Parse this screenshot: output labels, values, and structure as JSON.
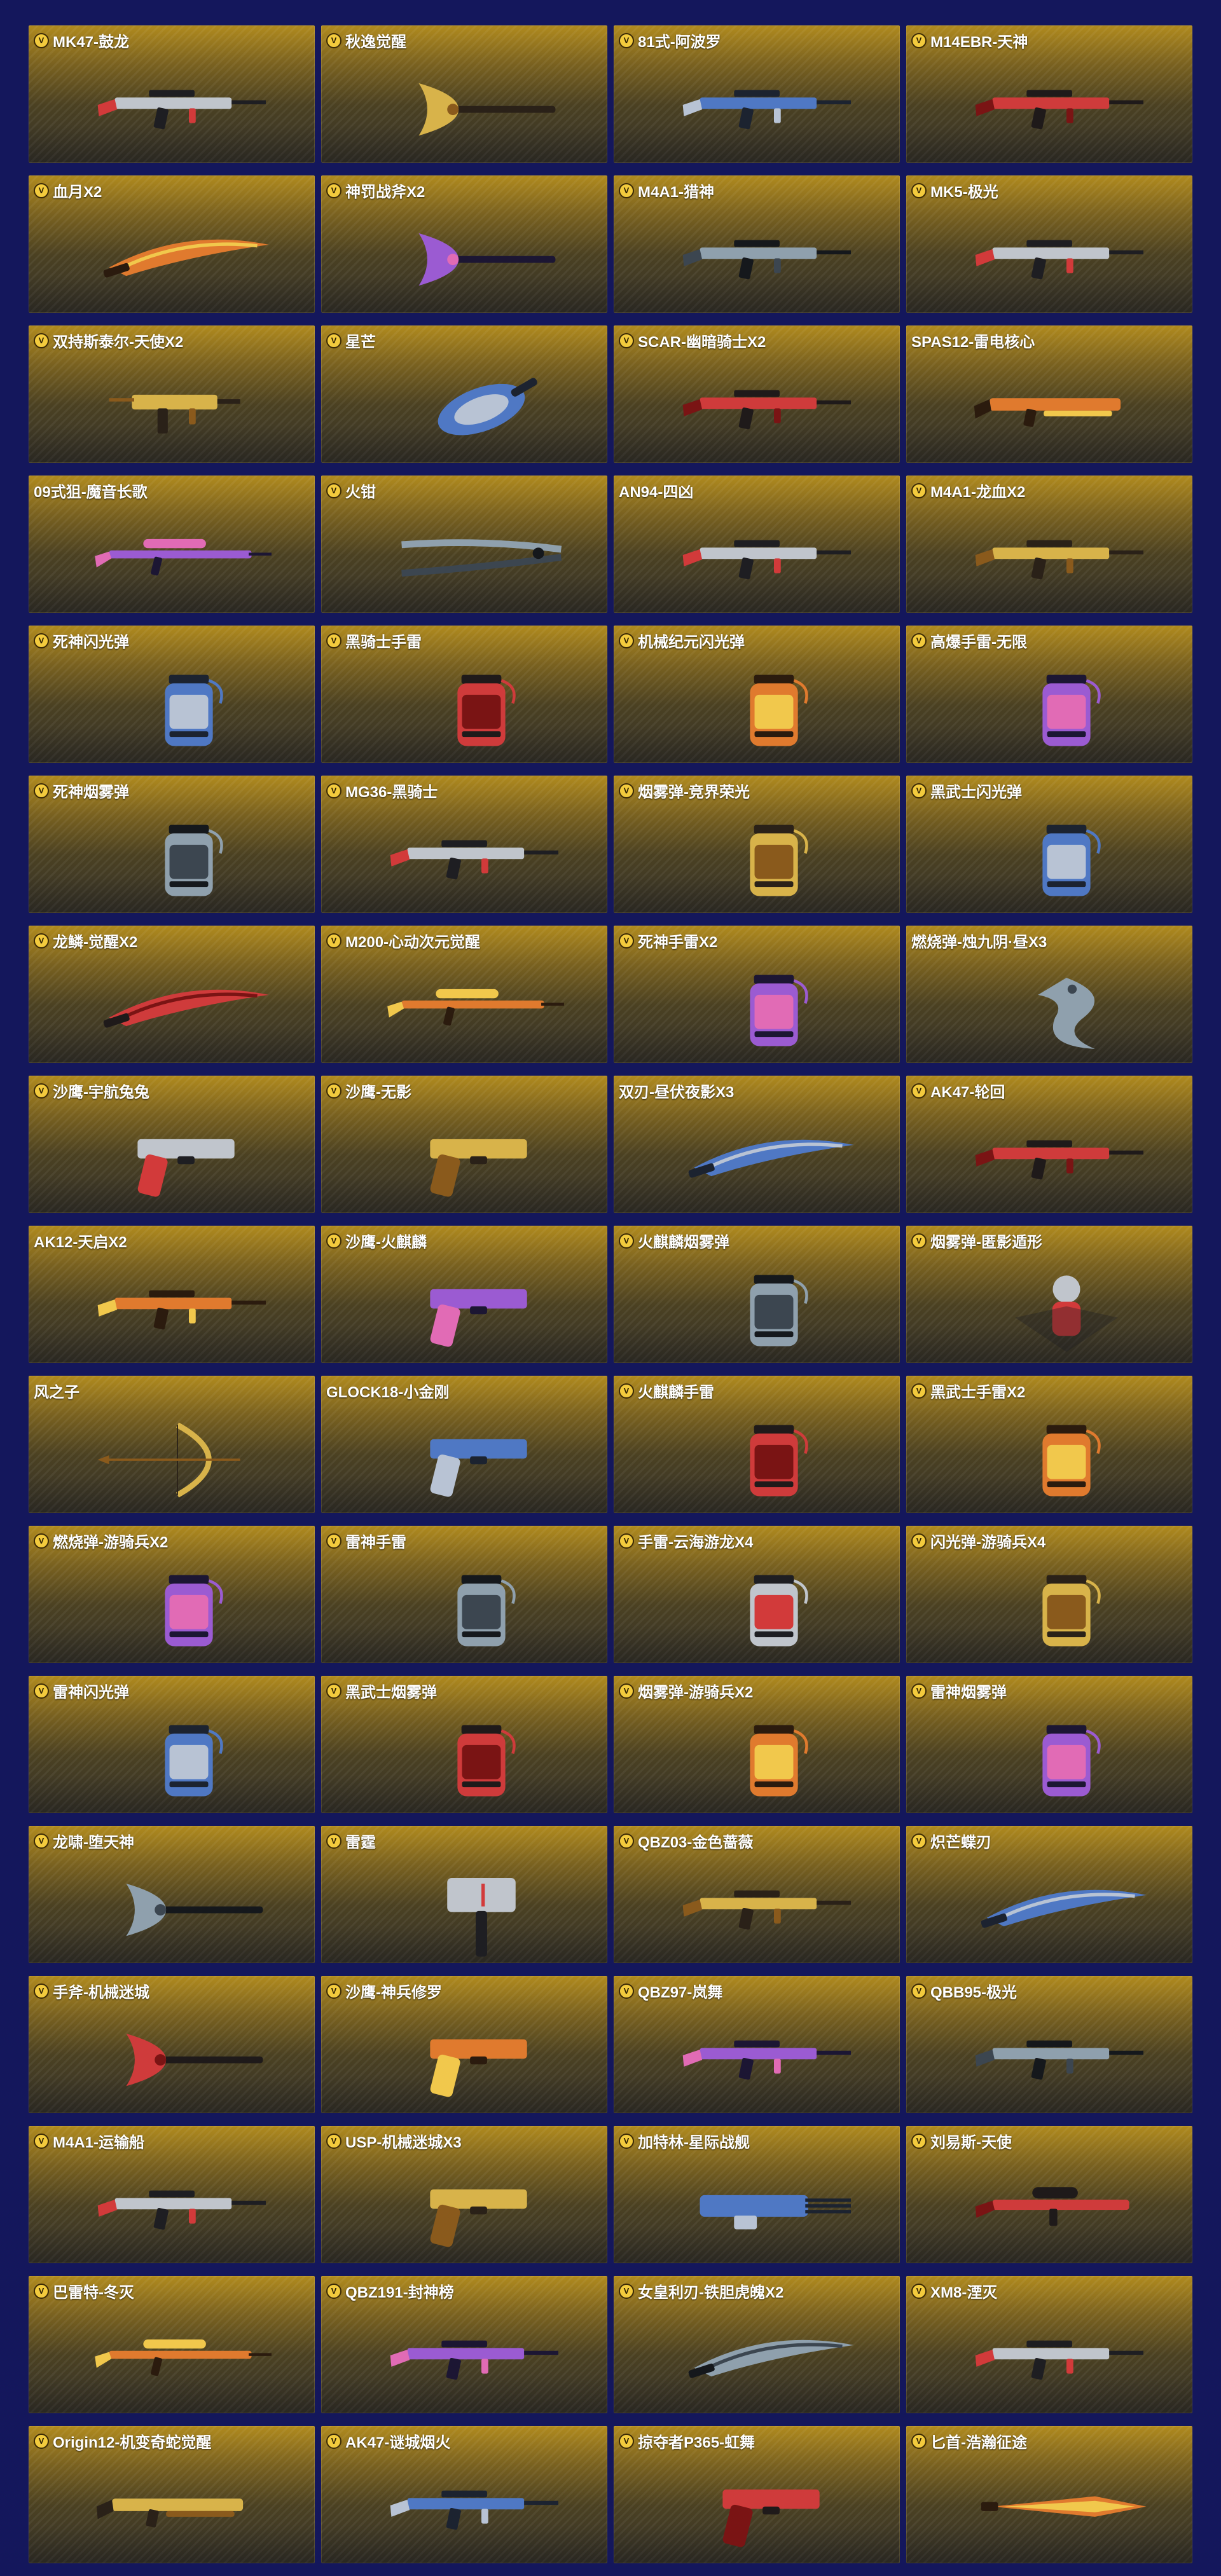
{
  "badge_glyph": "V",
  "colors": {
    "background": "#14175c",
    "badge": "#f3cb3d",
    "card_top": "#b08a1e",
    "card_bottom": "#35322a"
  },
  "items": [
    {
      "label": "MK47-鼓龙",
      "badge": true,
      "icon": "rifle-icon"
    },
    {
      "label": "秋逸觉醒",
      "badge": true,
      "icon": "axe-icon"
    },
    {
      "label": "81式-阿波罗",
      "badge": true,
      "icon": "rifle-icon"
    },
    {
      "label": "M14EBR-天神",
      "badge": true,
      "icon": "rifle-icon"
    },
    {
      "label": "血月X2",
      "badge": true,
      "icon": "blade-icon"
    },
    {
      "label": "神罚战斧X2",
      "badge": true,
      "icon": "axe-icon"
    },
    {
      "label": "M4A1-猎神",
      "badge": true,
      "icon": "rifle-icon"
    },
    {
      "label": "MK5-极光",
      "badge": true,
      "icon": "rifle-icon"
    },
    {
      "label": "双持斯泰尔-天使X2",
      "badge": true,
      "icon": "smg-icon"
    },
    {
      "label": "星芒",
      "badge": true,
      "icon": "gauntlet-icon"
    },
    {
      "label": "SCAR-幽暗骑士X2",
      "badge": true,
      "icon": "rifle-icon"
    },
    {
      "label": "SPAS12-雷电核心",
      "badge": false,
      "icon": "shotgun-icon"
    },
    {
      "label": "09式狙-魔音长歌",
      "badge": false,
      "icon": "sniper-icon"
    },
    {
      "label": "火钳",
      "badge": true,
      "icon": "tongs-icon"
    },
    {
      "label": "AN94-四凶",
      "badge": false,
      "icon": "rifle-icon"
    },
    {
      "label": "M4A1-龙血X2",
      "badge": true,
      "icon": "rifle-icon"
    },
    {
      "label": "死神闪光弹",
      "badge": true,
      "icon": "grenade-icon"
    },
    {
      "label": "黑骑士手雷",
      "badge": true,
      "icon": "grenade-icon"
    },
    {
      "label": "机械纪元闪光弹",
      "badge": true,
      "icon": "grenade-icon"
    },
    {
      "label": "高爆手雷-无限",
      "badge": true,
      "icon": "grenade-icon"
    },
    {
      "label": "死神烟雾弹",
      "badge": true,
      "icon": "grenade-icon"
    },
    {
      "label": "MG36-黑骑士",
      "badge": true,
      "icon": "rifle-icon"
    },
    {
      "label": "烟雾弹-竞界荣光",
      "badge": true,
      "icon": "grenade-icon"
    },
    {
      "label": "黑武士闪光弹",
      "badge": true,
      "icon": "grenade-icon"
    },
    {
      "label": "龙鳞-觉醒X2",
      "badge": true,
      "icon": "blade-icon"
    },
    {
      "label": "M200-心动次元觉醒",
      "badge": true,
      "icon": "sniper-icon"
    },
    {
      "label": "死神手雷X2",
      "badge": true,
      "icon": "grenade-icon"
    },
    {
      "label": "燃烧弹-烛九阴·昼X3",
      "badge": false,
      "icon": "dragon-figure-icon"
    },
    {
      "label": "沙鹰-宇航兔兔",
      "badge": true,
      "icon": "pistol-icon"
    },
    {
      "label": "沙鹰-无影",
      "badge": true,
      "icon": "pistol-icon"
    },
    {
      "label": "双刃-昼伏夜影X3",
      "badge": false,
      "icon": "blade-icon"
    },
    {
      "label": "AK47-轮回",
      "badge": true,
      "icon": "rifle-icon"
    },
    {
      "label": "AK12-天启X2",
      "badge": false,
      "icon": "rifle-icon"
    },
    {
      "label": "沙鹰-火麒麟",
      "badge": true,
      "icon": "pistol-icon"
    },
    {
      "label": "火麒麟烟雾弹",
      "badge": true,
      "icon": "grenade-icon"
    },
    {
      "label": "烟雾弹-匿影遁形",
      "badge": true,
      "icon": "figure-icon"
    },
    {
      "label": "风之子",
      "badge": false,
      "icon": "bow-icon"
    },
    {
      "label": "GLOCK18-小金刚",
      "badge": false,
      "icon": "pistol-icon"
    },
    {
      "label": "火麒麟手雷",
      "badge": true,
      "icon": "grenade-icon"
    },
    {
      "label": "黑武士手雷X2",
      "badge": true,
      "icon": "grenade-icon"
    },
    {
      "label": "燃烧弹-游骑兵X2",
      "badge": true,
      "icon": "grenade-icon"
    },
    {
      "label": "雷神手雷",
      "badge": true,
      "icon": "grenade-icon"
    },
    {
      "label": "手雷-云海游龙X4",
      "badge": true,
      "icon": "grenade-icon"
    },
    {
      "label": "闪光弹-游骑兵X4",
      "badge": true,
      "icon": "grenade-icon"
    },
    {
      "label": "雷神闪光弹",
      "badge": true,
      "icon": "grenade-icon"
    },
    {
      "label": "黑武士烟雾弹",
      "badge": true,
      "icon": "grenade-icon"
    },
    {
      "label": "烟雾弹-游骑兵X2",
      "badge": true,
      "icon": "grenade-icon"
    },
    {
      "label": "雷神烟雾弹",
      "badge": true,
      "icon": "grenade-icon"
    },
    {
      "label": "龙啸-堕天神",
      "badge": true,
      "icon": "axe-icon"
    },
    {
      "label": "雷霆",
      "badge": true,
      "icon": "hammer-icon"
    },
    {
      "label": "QBZ03-金色蔷薇",
      "badge": true,
      "icon": "rifle-icon"
    },
    {
      "label": "炽芒蝶刃",
      "badge": true,
      "icon": "blade-icon"
    },
    {
      "label": "手斧-机械迷城",
      "badge": true,
      "icon": "axe-icon"
    },
    {
      "label": "沙鹰-神兵修罗",
      "badge": true,
      "icon": "pistol-icon"
    },
    {
      "label": "QBZ97-岚舞",
      "badge": true,
      "icon": "rifle-icon"
    },
    {
      "label": "QBB95-极光",
      "badge": true,
      "icon": "rifle-icon"
    },
    {
      "label": "M4A1-运输船",
      "badge": true,
      "icon": "rifle-icon"
    },
    {
      "label": "USP-机械迷城X3",
      "badge": true,
      "icon": "pistol-icon"
    },
    {
      "label": "加特林-星际战舰",
      "badge": true,
      "icon": "gatling-icon"
    },
    {
      "label": "刘易斯-天使",
      "badge": true,
      "icon": "machine-gun-icon"
    },
    {
      "label": "巴雷特-冬灭",
      "badge": true,
      "icon": "sniper-icon"
    },
    {
      "label": "QBZ191-封神榜",
      "badge": true,
      "icon": "rifle-icon"
    },
    {
      "label": "女皇利刃-铁胆虎魄X2",
      "badge": true,
      "icon": "blade-icon"
    },
    {
      "label": "XM8-湮灭",
      "badge": true,
      "icon": "rifle-icon"
    },
    {
      "label": "Origin12-机变奇蛇觉醒",
      "badge": true,
      "icon": "shotgun-icon"
    },
    {
      "label": "AK47-谜城烟火",
      "badge": true,
      "icon": "rifle-icon"
    },
    {
      "label": "掠夺者P365-虹舞",
      "badge": true,
      "icon": "pistol-icon"
    },
    {
      "label": "匕首-浩瀚征途",
      "badge": true,
      "icon": "dagger-icon"
    }
  ]
}
